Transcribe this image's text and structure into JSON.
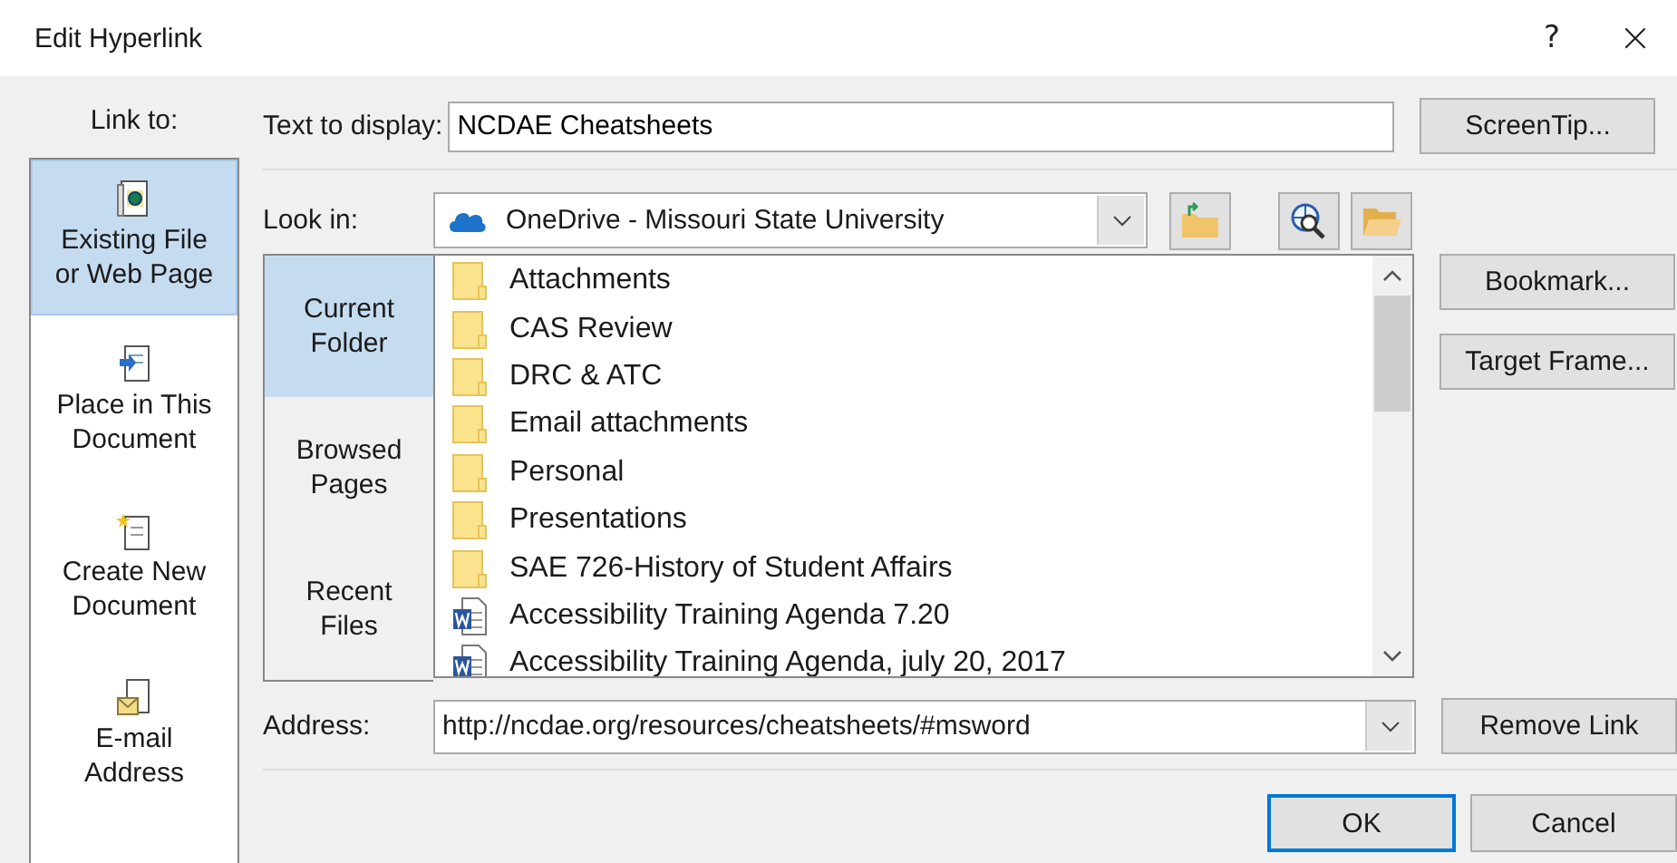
{
  "window": {
    "title": "Edit Hyperlink",
    "help": "?",
    "close": "×"
  },
  "link_to": {
    "label": "Link to:",
    "items": [
      {
        "kind": "file",
        "label": "Existing File\nor Web Page",
        "selected": true
      },
      {
        "kind": "place",
        "label": "Place in This\nDocument",
        "selected": false
      },
      {
        "kind": "new",
        "label": "Create New\nDocument",
        "selected": false
      },
      {
        "kind": "email",
        "label": "E-mail\nAddress",
        "selected": false
      }
    ]
  },
  "text_to_display": {
    "label": "Text to display:",
    "value": "NCDAE Cheatsheets"
  },
  "look_in": {
    "label": "Look in:",
    "value": "OneDrive - Missouri State University"
  },
  "views": [
    {
      "label": "Current\nFolder",
      "selected": true
    },
    {
      "label": "Browsed\nPages",
      "selected": false
    },
    {
      "label": "Recent\nFiles",
      "selected": false
    }
  ],
  "files": [
    {
      "kind": "folder",
      "name": "Attachments"
    },
    {
      "kind": "folder",
      "name": "CAS Review"
    },
    {
      "kind": "folder",
      "name": "DRC & ATC"
    },
    {
      "kind": "folder",
      "name": "Email attachments"
    },
    {
      "kind": "folder",
      "name": "Personal"
    },
    {
      "kind": "folder",
      "name": "Presentations"
    },
    {
      "kind": "folder",
      "name": "SAE 726-History of Student Affairs"
    },
    {
      "kind": "word",
      "name": "Accessibility Training Agenda 7.20"
    },
    {
      "kind": "word",
      "name": "Accessibility Training Agenda, july 20, 2017"
    }
  ],
  "address": {
    "label": "Address:",
    "value": "http://ncdae.org/resources/cheatsheets/#msword"
  },
  "side_buttons": [
    "ScreenTip...",
    "Bookmark...",
    "Target Frame...",
    "Remove Link"
  ],
  "footer_buttons": [
    {
      "label": "OK",
      "default": true
    },
    {
      "label": "Cancel",
      "default": false
    }
  ]
}
